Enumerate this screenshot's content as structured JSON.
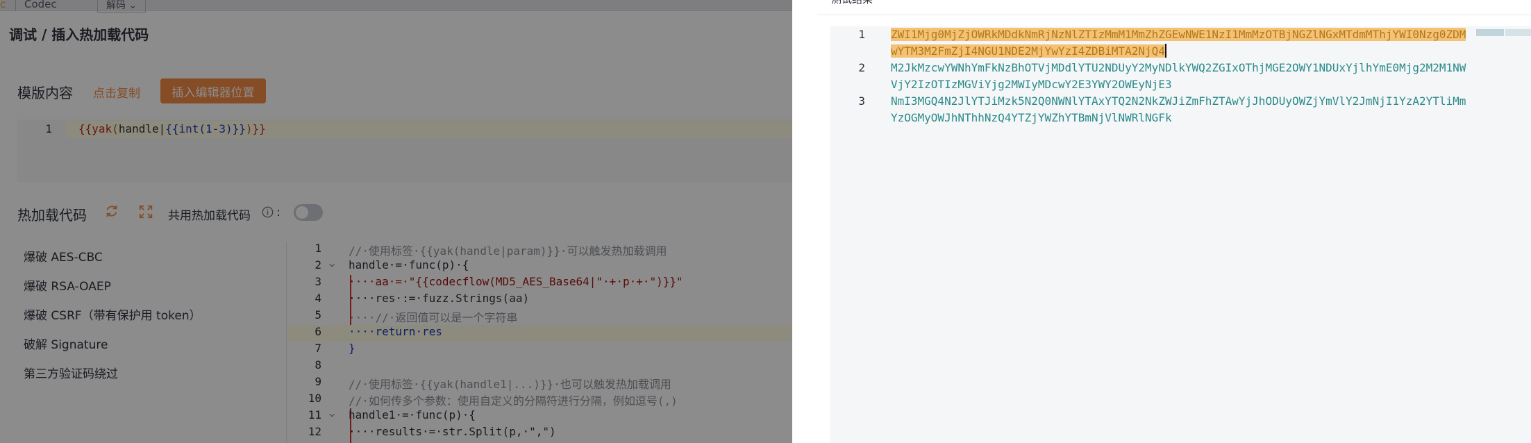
{
  "top_tabs": {
    "frag_a": "c",
    "frag_b": "Codec",
    "frag_c": "解码 ⌄"
  },
  "page_title": "调试 / 插入热加载代码",
  "template_section": {
    "label": "模版内容",
    "copy_link": "点击复制",
    "insert_button": "插入编辑器位置",
    "editor": {
      "line_number": "1",
      "tokens": {
        "open": "{{",
        "fn": "yak",
        "paren_open": "(",
        "arg": "handle",
        "pipe": "|",
        "inner_open": "{{",
        "inner_fn": "int",
        "inner_arg": "(1-3)",
        "inner_close": "}}",
        "paren_close": ")",
        "close": "}}"
      }
    }
  },
  "hot_reload_section": {
    "label": "热加载代码",
    "refresh_icon": "refresh-icon",
    "expand_icon": "expand-icon",
    "share_label": "共用热加载代码",
    "info_icon": "info-circle-icon",
    "colon": ":",
    "share_enabled": false
  },
  "sidebar": {
    "items": [
      {
        "label": "爆破 AES-CBC"
      },
      {
        "label": "爆破 RSA-OAEP"
      },
      {
        "label": "爆破 CSRF（带有保护用 token）"
      },
      {
        "label": "破解 Signature"
      },
      {
        "label": "第三方验证码绕过"
      }
    ]
  },
  "code_editor": {
    "lines": [
      {
        "num": "1",
        "text": "//·使用标签·{{yak(handle|param)}}·可以触发热加载调用"
      },
      {
        "num": "2",
        "text": "handle·=·func(p)·{"
      },
      {
        "num": "3",
        "text": "····aa·=·\"{{codecflow(MD5_AES_Base64|\"·+·p·+·\")}}\""
      },
      {
        "num": "4",
        "text": "····res·:=·fuzz.Strings(aa)"
      },
      {
        "num": "5",
        "text": "····//·返回值可以是一个字符串"
      },
      {
        "num": "6",
        "text": "····return·res"
      },
      {
        "num": "7",
        "text": "}"
      },
      {
        "num": "8",
        "text": ""
      },
      {
        "num": "9",
        "text": "//·使用标签·{{yak(handle1|...)}}·也可以触发热加载调用"
      },
      {
        "num": "10",
        "text": "//·如何传多个参数：使用自定义的分隔符进行分隔，例如逗号(,)"
      },
      {
        "num": "11",
        "text": "handle1·=·func(p)·{"
      },
      {
        "num": "12",
        "text": "····results·=·str.Split(p,·\",\")"
      }
    ]
  },
  "drawer": {
    "top_fragment": "测试结果",
    "results": [
      {
        "num": "1",
        "text": "ZWI1Mjg0MjZjOWRkMDdkNmRjNzNlZTIzMmM1MmZhZGEwNWE1NzI1MmMzOTBjNGZlNGxMTdmMThjYWI0Nzg0ZDMwYTM3M2FmZjI4NGU1NDE2MjYwYzI4ZDBiMTA2NjQ4",
        "selected": true
      },
      {
        "num": "2",
        "text": "M2JkMzcwYWNhYmFkNzBhOTVjMDdlYTU2NDUyY2MyNDlkYWQ2ZGIxOThjMGE2OWY1NDUxYjlhYmE0Mjg2M2M1NWVjY2IzOTIzMGViYjg2MWIyMDcwY2E3YWY2OWEyNjE3",
        "selected": false
      },
      {
        "num": "3",
        "text": "NmI3MGQ4N2JlYTJiMzk5N2Q0NWNlYTAxYTQ2N2NkZWJiZmFhZTAwYjJhODUyOWZjYmVlY2JmNjI1YzA2YTliMmYzOGMyOWJhNThhNzQ4YTZjYWZhYTBmNjVlNWRlNGFk",
        "selected": false
      }
    ]
  },
  "colors": {
    "accent": "#f28b44",
    "result_text": "#2b8a8a",
    "selection": "#f5c175",
    "mask": "rgba(0,0,0,0.45)"
  }
}
